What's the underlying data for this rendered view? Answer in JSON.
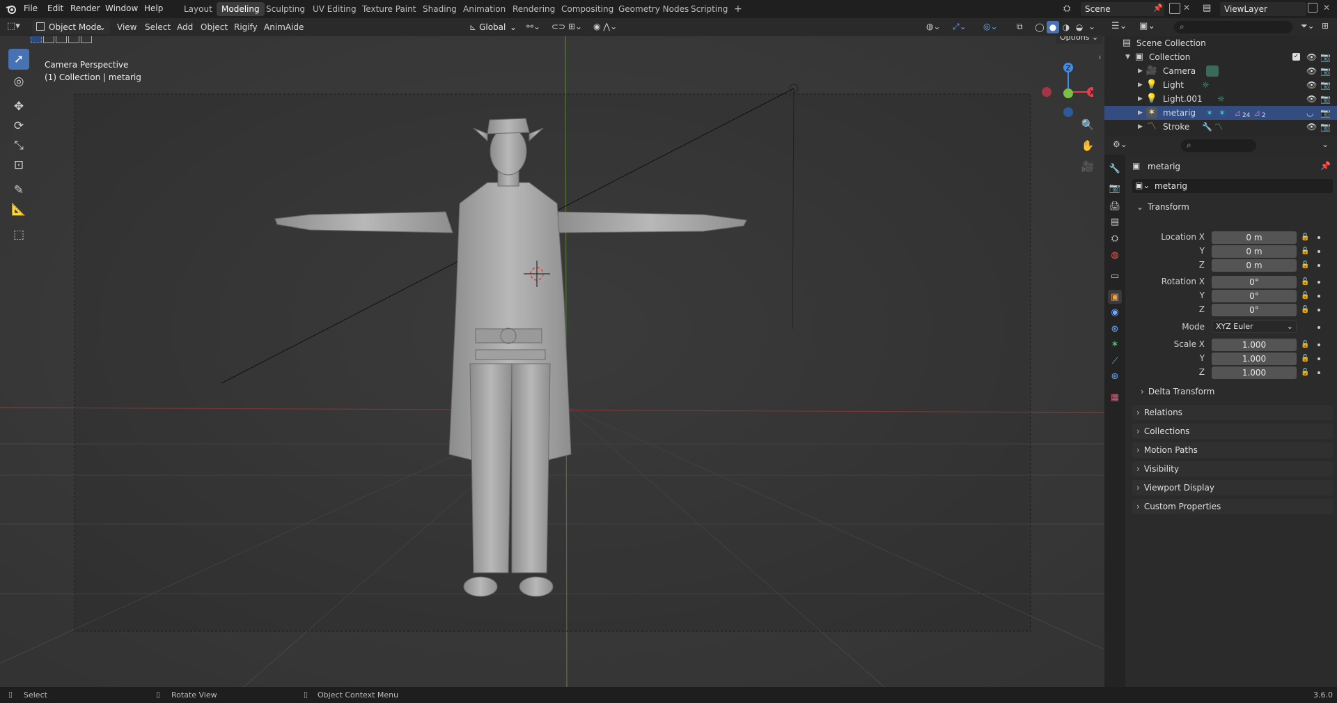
{
  "menu": [
    "File",
    "Edit",
    "Render",
    "Window",
    "Help"
  ],
  "workspaces": [
    "Layout",
    "Modeling",
    "Sculpting",
    "UV Editing",
    "Texture Paint",
    "Shading",
    "Animation",
    "Rendering",
    "Compositing",
    "Geometry Nodes",
    "Scripting"
  ],
  "active_workspace": "Modeling",
  "add_workspace": "+",
  "scene": "Scene",
  "view_layer": "ViewLayer",
  "viewport_header": {
    "mode": "Object Mode",
    "menus": [
      "View",
      "Select",
      "Add",
      "Object",
      "Rigify",
      "AnimAide"
    ],
    "orientation": "Global",
    "options": "Options"
  },
  "viewport": {
    "line1": "Camera Perspective",
    "line2": "(1) Collection | metarig",
    "gizmo": {
      "z": "Z",
      "x": "X"
    }
  },
  "outliner": {
    "rows": [
      {
        "label": "Scene Collection",
        "icon": "scene-collection-icon"
      },
      {
        "label": "Collection",
        "icon": "collection-icon"
      },
      {
        "label": "Camera",
        "icon": "camera-object-icon"
      },
      {
        "label": "Light",
        "icon": "light-object-icon"
      },
      {
        "label": "Light.001",
        "icon": "light-object-icon"
      },
      {
        "label": "metarig",
        "icon": "armature-object-icon",
        "badge_a": "24",
        "badge_b": "2"
      },
      {
        "label": "Stroke",
        "icon": "grease-pencil-icon"
      }
    ]
  },
  "properties": {
    "object_name": "metarig",
    "data_name": "metarig",
    "transform_label": "Transform",
    "location_label": "Location X",
    "rotation_label": "Rotation X",
    "scale_label": "Scale X",
    "mode_label": "Mode",
    "axis_y": "Y",
    "axis_z": "Z",
    "location": [
      "0 m",
      "0 m",
      "0 m"
    ],
    "rotation": [
      "0°",
      "0°",
      "0°"
    ],
    "mode": "XYZ Euler",
    "scale": [
      "1.000",
      "1.000",
      "1.000"
    ],
    "delta_transform": "Delta Transform",
    "sections": [
      "Relations",
      "Collections",
      "Motion Paths",
      "Visibility",
      "Viewport Display",
      "Custom Properties"
    ]
  },
  "status": {
    "select": "Select",
    "rotate": "Rotate View",
    "context": "Object Context Menu",
    "version": "3.6.0"
  },
  "colors": {
    "accent": "#4772b3",
    "selected_row": "#334d80",
    "axis_x": "#e53e4f",
    "axis_y": "#7bc043",
    "axis_z": "#3d8ee8"
  }
}
